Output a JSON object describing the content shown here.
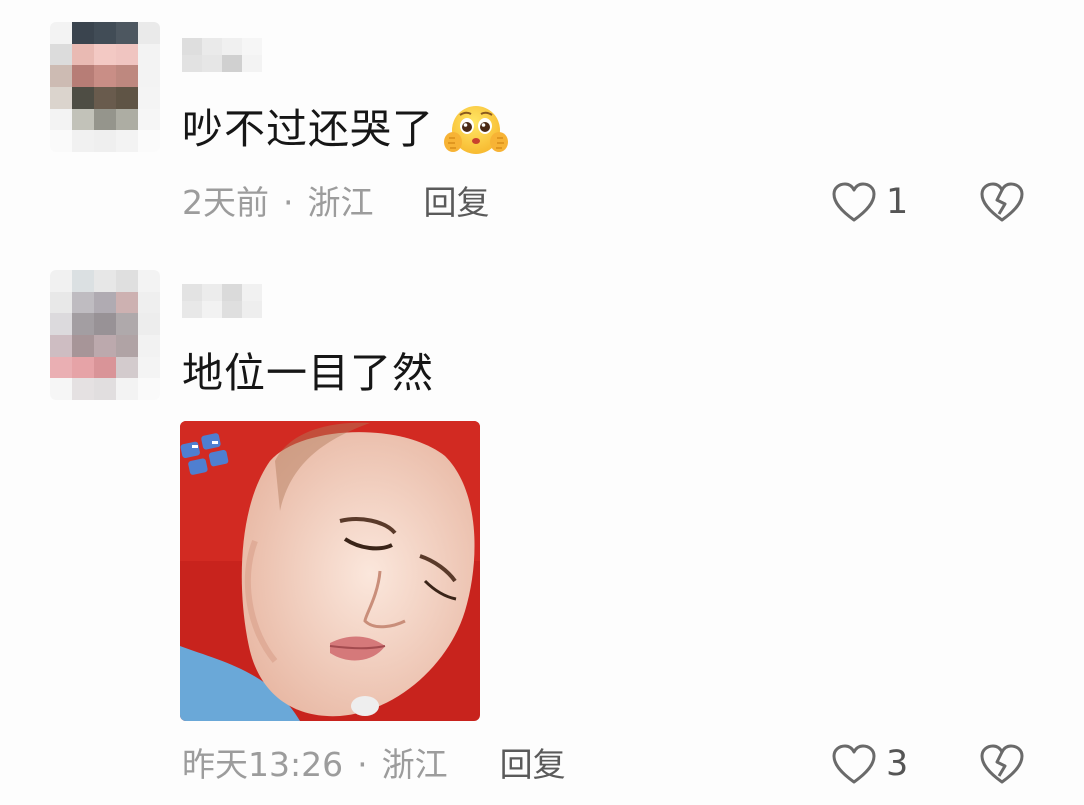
{
  "comments": [
    {
      "text": "吵不过还哭了",
      "emoji": "pleading-face-emoji",
      "time": "2天前",
      "separator": "·",
      "location": "浙江",
      "reply_label": "回复",
      "like_count": "1"
    },
    {
      "text": "地位一目了然",
      "image": "sticker-image",
      "time": "昨天13:26",
      "separator": "·",
      "location": "浙江",
      "reply_label": "回复",
      "like_count": "3"
    }
  ],
  "icons": {
    "like": "heart-outline-icon",
    "dislike": "broken-heart-icon"
  },
  "colors": {
    "text": "#161616",
    "meta": "#9c9c9c",
    "reply": "#5a5a5a",
    "icon": "#6a6a6a"
  }
}
